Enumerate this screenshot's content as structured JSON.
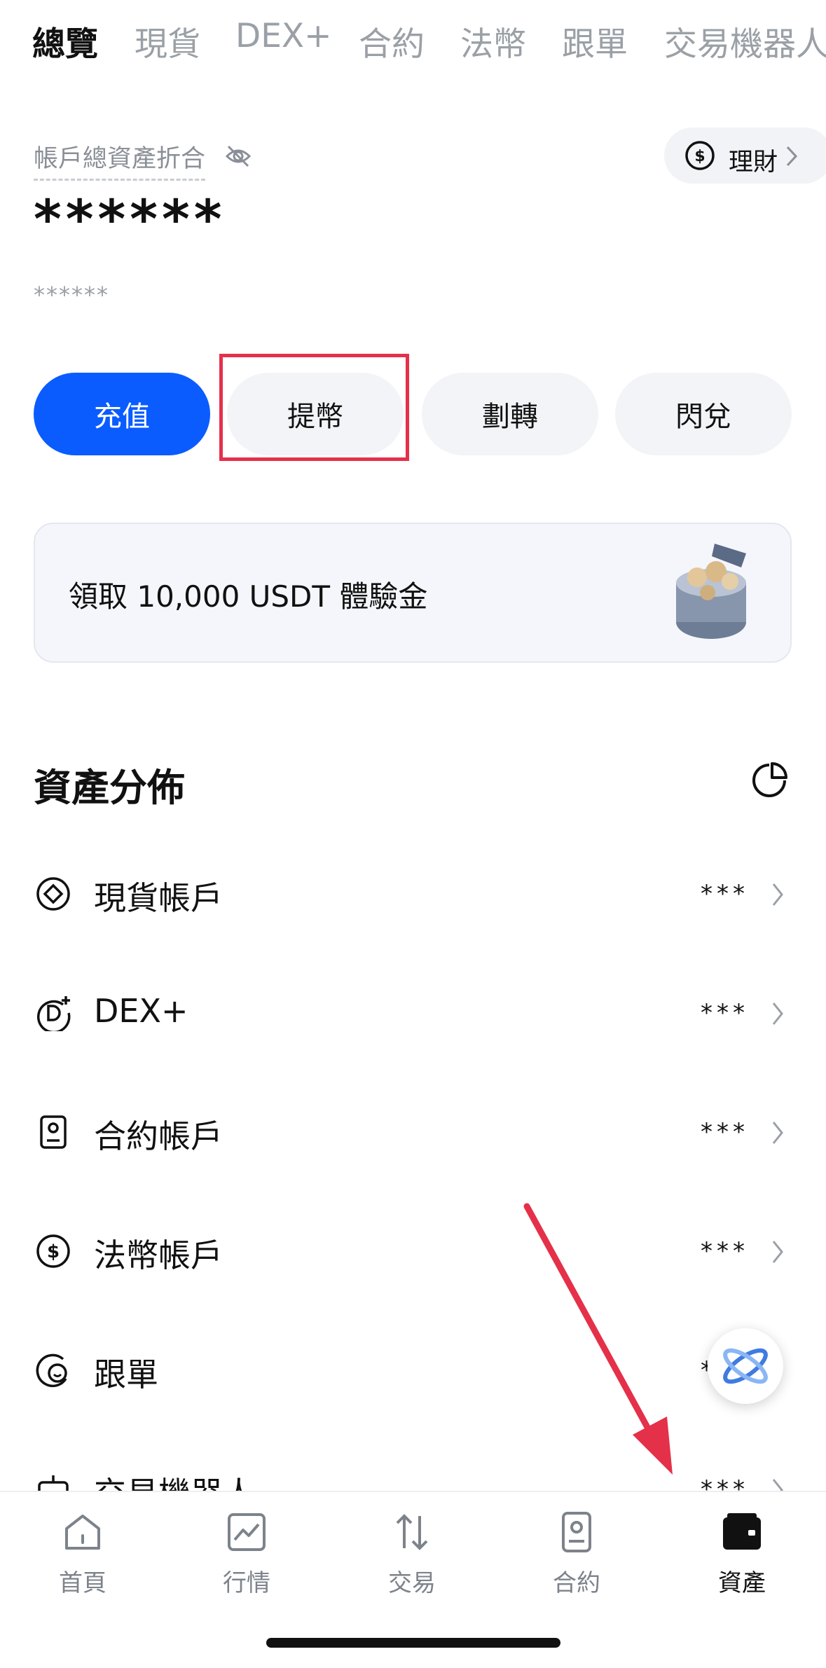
{
  "top_tabs": [
    "總覽",
    "現貨",
    "DEX+",
    "合約",
    "法幣",
    "跟單",
    "交易機器人"
  ],
  "account": {
    "label": "帳戶總資產折合",
    "balance_mask": "******",
    "sub_mask": "******",
    "wealth_label": "理財"
  },
  "actions": {
    "deposit": "充值",
    "withdraw": "提幣",
    "transfer": "劃轉",
    "convert": "閃兌"
  },
  "promo": {
    "text": "領取 10,000 USDT 體驗金"
  },
  "distribution": {
    "title": "資產分佈",
    "rows": [
      {
        "label": "現貨帳戶",
        "value": "***",
        "icon": "diamond-circle-icon"
      },
      {
        "label": "DEX+",
        "value": "***",
        "icon": "dex-plus-icon"
      },
      {
        "label": "合約帳戶",
        "value": "***",
        "icon": "contract-doc-icon"
      },
      {
        "label": "法幣帳戶",
        "value": "***",
        "icon": "dollar-circle-icon"
      },
      {
        "label": "跟單",
        "value": "*",
        "icon": "copy-trade-icon"
      },
      {
        "label": "交易機器人",
        "value": "***",
        "icon": "bot-icon"
      }
    ]
  },
  "bottom_nav": [
    {
      "label": "首頁",
      "icon": "home-icon"
    },
    {
      "label": "行情",
      "icon": "chart-icon"
    },
    {
      "label": "交易",
      "icon": "trade-arrows-icon"
    },
    {
      "label": "合約",
      "icon": "contract-icon"
    },
    {
      "label": "資產",
      "icon": "wallet-icon"
    }
  ],
  "colors": {
    "accent": "#0a5cff",
    "annotation_red": "#e5304a",
    "muted_text": "#8a8f97"
  }
}
